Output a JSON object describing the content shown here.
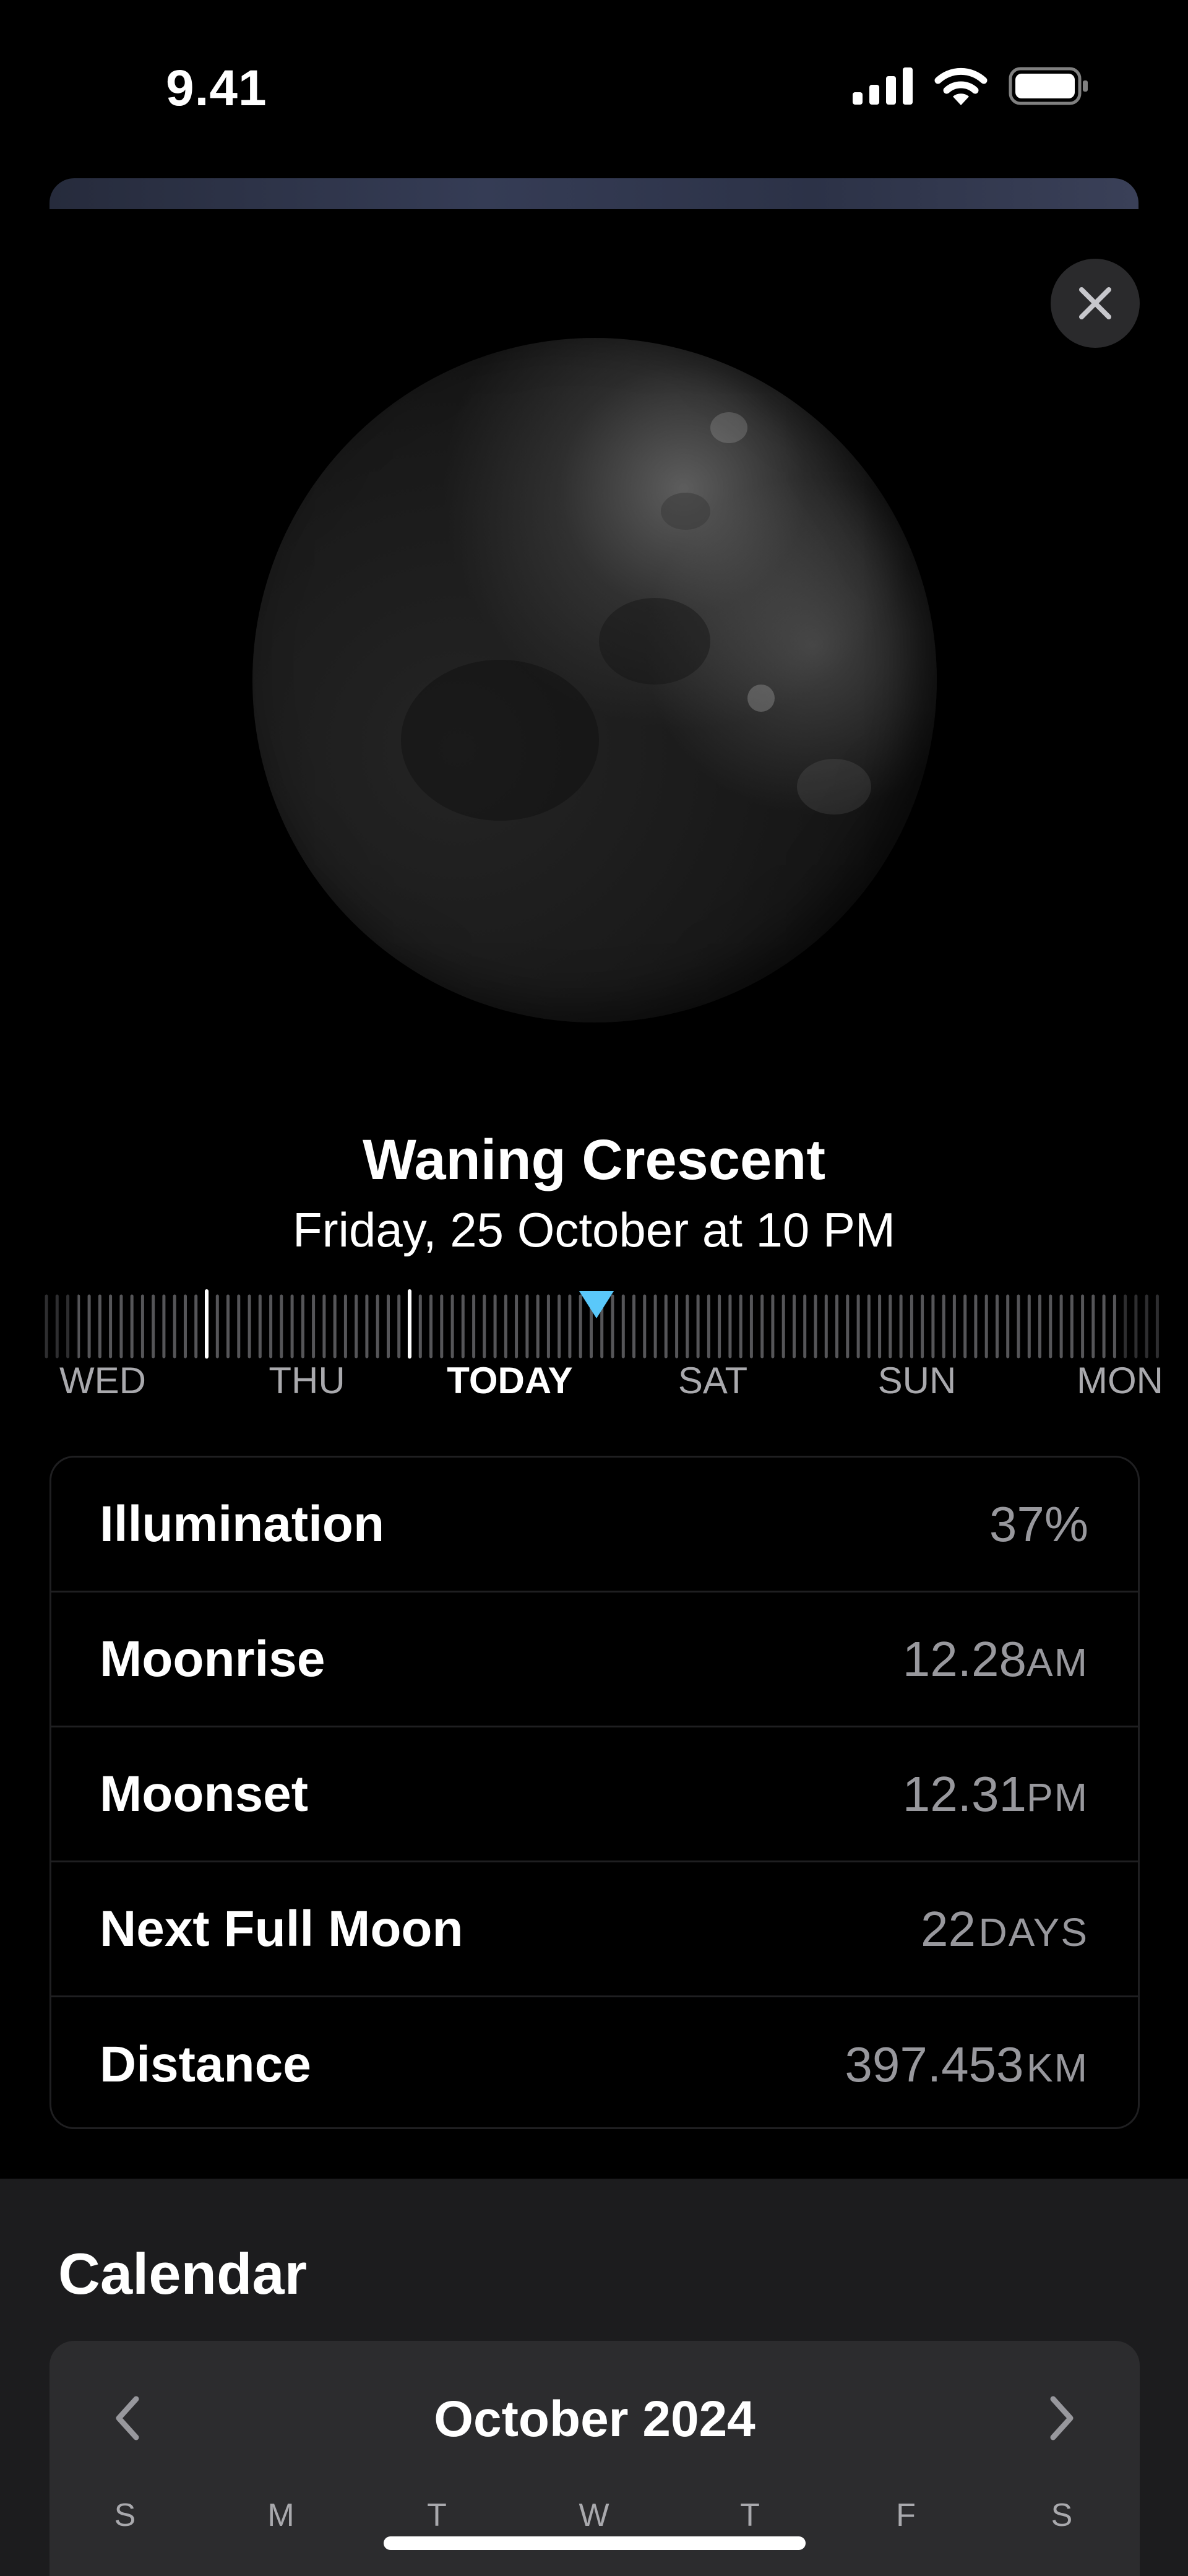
{
  "status_bar": {
    "time": "9.41",
    "icons": [
      "cellular-signal-icon",
      "wifi-icon",
      "battery-icon"
    ]
  },
  "close_icon": "close-icon",
  "moon": {
    "phase": "Waning Crescent",
    "date": "Friday, 25 October at 10 PM"
  },
  "timeline": {
    "days": [
      "WED",
      "THU",
      "TODAY",
      "SAT",
      "SUN",
      "MON"
    ],
    "current_day": "TODAY",
    "marker_color": "#5ac8fa"
  },
  "details": [
    {
      "label": "Illumination",
      "value": "37%",
      "unit": ""
    },
    {
      "label": "Moonrise",
      "value": "12.28",
      "unit": "AM"
    },
    {
      "label": "Moonset",
      "value": "12.31",
      "unit": "PM"
    },
    {
      "label": "Next Full Moon",
      "value": "22",
      "unit": "DAYS"
    },
    {
      "label": "Distance",
      "value": "397.453",
      "unit": "KM"
    }
  ],
  "calendar": {
    "title": "Calendar",
    "month": "October 2024",
    "weekdays": [
      "S",
      "M",
      "T",
      "W",
      "T",
      "F",
      "S"
    ]
  }
}
